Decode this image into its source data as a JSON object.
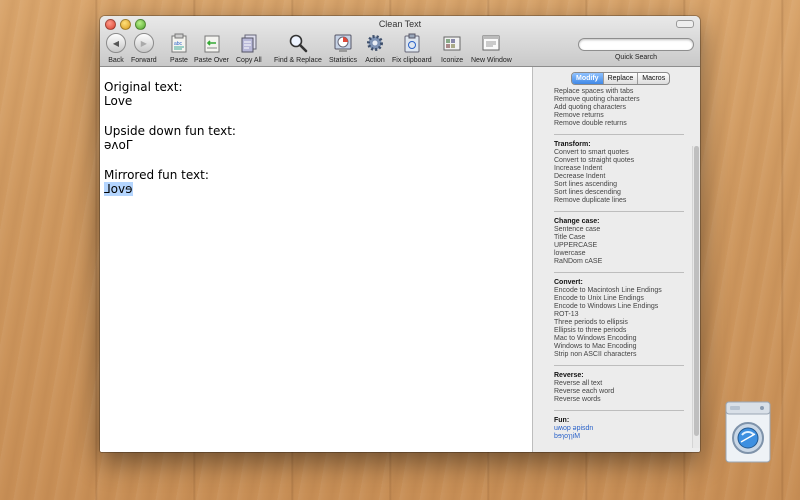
{
  "window": {
    "title": "Clean Text"
  },
  "toolbar": {
    "back": "Back",
    "forward": "Forward",
    "paste": "Paste",
    "paste_over": "Paste Over",
    "copy_all": "Copy All",
    "find_replace": "Find & Replace",
    "statistics": "Statistics",
    "action": "Action",
    "fix_clipboard": "Fix clipboard",
    "iconize": "Iconize",
    "new_window": "New Window",
    "quick_search_label": "Quick Search",
    "quick_search_value": ""
  },
  "editor": {
    "original_heading": "Original text:",
    "original_value": "Love",
    "upside_heading": "Upside down fun text:",
    "upside_value": "ǝʌoΓ",
    "mirrored_heading": "Mirrored fun text:",
    "mirrored_value": "evoL"
  },
  "sidebar": {
    "tabs": [
      "Modify",
      "Replace",
      "Macros"
    ],
    "active_tab": "Modify",
    "top_items": [
      "Replace spaces with tabs",
      "Remove quoting characters",
      "Add quoting characters",
      "Remove returns",
      "Remove double returns"
    ],
    "transform": {
      "title": "Transform:",
      "items": [
        "Convert to smart quotes",
        "Convert to straight quotes",
        "Increase Indent",
        "Decrease Indent",
        "Sort lines ascending",
        "Sort lines descending",
        "Remove duplicate lines"
      ]
    },
    "change_case": {
      "title": "Change case:",
      "items": [
        "Sentence case",
        "Title Case",
        "UPPERCASE",
        "lowercase",
        "RaNDom cASE"
      ]
    },
    "convert": {
      "title": "Convert:",
      "items": [
        "Encode to Macintosh Line Endings",
        "Encode to Unix Line Endings",
        "Encode to Windows Line Endings",
        "ROT-13",
        "Three periods to ellipsis",
        "Ellipsis to three periods",
        "Mac to Windows Encoding",
        "Windows to Mac Encoding",
        "Strip non ASCII characters"
      ]
    },
    "reverse": {
      "title": "Reverse:",
      "items": [
        "Reverse all text",
        "Reverse each word",
        "Reverse words"
      ]
    },
    "fun": {
      "title": "Fun:",
      "items": [
        "uʍop ǝpisdn",
        "bɘɿoɿɿiM"
      ]
    }
  },
  "colors": {
    "selection": "#b4d5fe",
    "tab_active": "#3f88e6",
    "link": "#2a62c9"
  }
}
